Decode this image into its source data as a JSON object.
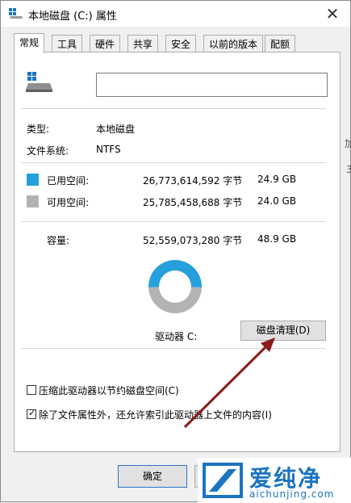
{
  "window": {
    "title": "本地磁盘 (C:) 属性",
    "close_glyph": "✕"
  },
  "tabs": [
    {
      "label": "常规",
      "active": true
    },
    {
      "label": "工具"
    },
    {
      "label": "硬件"
    },
    {
      "label": "共享"
    },
    {
      "label": "安全"
    },
    {
      "label": "以前的版本"
    },
    {
      "label": "配额"
    }
  ],
  "general": {
    "name_value": "",
    "type_label": "类型:",
    "type_value": "本地磁盘",
    "fs_label": "文件系统:",
    "fs_value": "NTFS",
    "used_label": "已用空间:",
    "used_bytes": "26,773,614,592 字节",
    "used_gb": "24.9 GB",
    "free_label": "可用空间:",
    "free_bytes": "25,785,458,688 字节",
    "free_gb": "24.0 GB",
    "capacity_label": "容量:",
    "capacity_bytes": "52,559,073,280 字节",
    "capacity_gb": "48.9 GB",
    "drive_label": "驱动器 C:",
    "cleanup_button": "磁盘清理(D)",
    "compress_label": "压缩此驱动器以节约磁盘空间(C)",
    "compress_checked": false,
    "index_label": "除了文件属性外，还允许索引此驱动器上文件的内容(I)",
    "index_checked": true
  },
  "chart_data": {
    "type": "pie",
    "categories": [
      "已用空间",
      "可用空间"
    ],
    "values": [
      24.9,
      24.0
    ],
    "colors": [
      "#26a0da",
      "#b3b3b3"
    ]
  },
  "buttons": {
    "ok": "确定"
  },
  "side": {
    "top": "加",
    "bottom": "3"
  },
  "watermark": {
    "title": "爱纯净",
    "url": "aichunjing.com"
  },
  "colors": {
    "used": "#26a0da",
    "free": "#b3b3b3",
    "arrow": "#8b1a1a",
    "brand": "#1b74c0"
  }
}
